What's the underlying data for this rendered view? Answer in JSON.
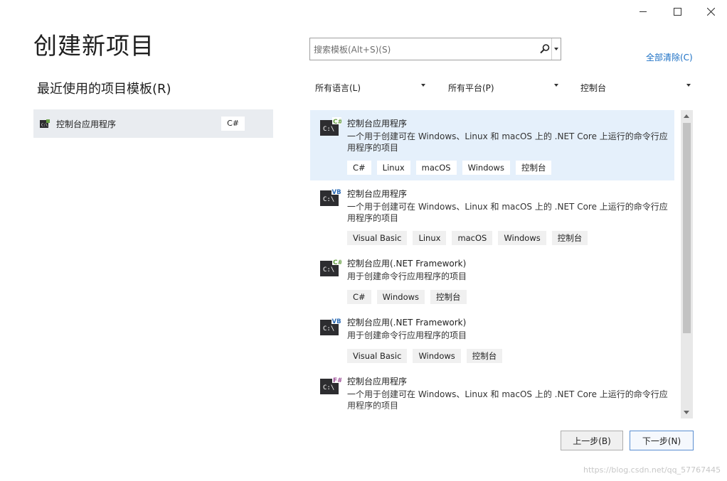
{
  "window": {
    "minimize_icon": "minimize-icon",
    "maximize_icon": "maximize-icon",
    "close_icon": "close-icon"
  },
  "page": {
    "title": "创建新项目"
  },
  "recent": {
    "heading": "最近使用的项目模板(R)",
    "items": [
      {
        "label": "控制台应用程序",
        "language": "C#",
        "icon": "console-app-icon"
      }
    ]
  },
  "search": {
    "placeholder": "搜索模板(Alt+S)(S)",
    "value": ""
  },
  "clear_all": "全部清除(C)",
  "filters": {
    "language": "所有语言(L)",
    "platform": "所有平台(P)",
    "project_type": "控制台"
  },
  "templates": [
    {
      "name": "控制台应用程序",
      "description": "一个用于创建可在 Windows、Linux 和 macOS 上的 .NET Core 上运行的命令行应用程序的项目",
      "badge": "C#",
      "tags": [
        "C#",
        "Linux",
        "macOS",
        "Windows",
        "控制台"
      ]
    },
    {
      "name": "控制台应用程序",
      "description": "一个用于创建可在 Windows、Linux 和 macOS 上的 .NET Core 上运行的命令行应用程序的项目",
      "badge": "VB",
      "tags": [
        "Visual Basic",
        "Linux",
        "macOS",
        "Windows",
        "控制台"
      ]
    },
    {
      "name": "控制台应用(.NET Framework)",
      "description": "用于创建命令行应用程序的项目",
      "badge": "C#",
      "tags": [
        "C#",
        "Windows",
        "控制台"
      ]
    },
    {
      "name": "控制台应用(.NET Framework)",
      "description": "用于创建命令行应用程序的项目",
      "badge": "VB",
      "tags": [
        "Visual Basic",
        "Windows",
        "控制台"
      ]
    },
    {
      "name": "控制台应用程序",
      "description": "一个用于创建可在 Windows、Linux 和 macOS 上的 .NET Core 上运行的命令行应用程序的项目",
      "badge": "F#",
      "tags": []
    }
  ],
  "buttons": {
    "back": "上一步(B)",
    "next": "下一步(N)"
  },
  "watermark": "https://blog.csdn.net/qq_57767445",
  "colors": {
    "accent": "#1a6fc4",
    "selected_bg": "#e5f0fb",
    "csharp": "#68a044",
    "vb": "#2b6bb5",
    "fsharp": "#9b4f96"
  }
}
